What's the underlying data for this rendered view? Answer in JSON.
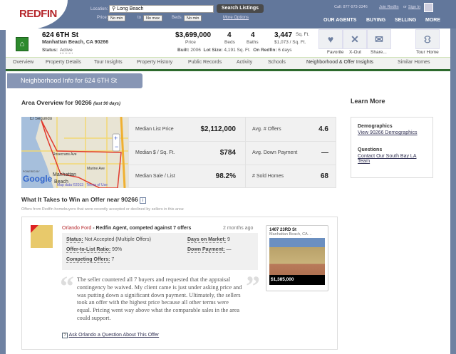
{
  "header": {
    "logo": "REDFIN",
    "location_label": "Location:",
    "location_value": "Long Beach",
    "search_button": "Search Listings",
    "price_label": "Price:",
    "price_min": "No min",
    "to_label": "to",
    "price_max": "No max",
    "beds_label": "Beds:",
    "beds_min": "No min",
    "more_options": "More Options",
    "phone": "Call: 877-973-3346",
    "join": "Join Redfin",
    "or": "or",
    "sign_in": "Sign In",
    "nav": [
      "OUR AGENTS",
      "BUYING",
      "SELLING",
      "MORE"
    ]
  },
  "property": {
    "address": "624 6TH St",
    "city": "Manhattan Beach, CA 90266",
    "status_label": "Status:",
    "status": "Active",
    "price": "$3,699,000",
    "price_label": "Price",
    "beds": "4",
    "beds_label": "Beds",
    "baths": "4",
    "baths_label": "Baths",
    "sqft": "3,447",
    "sqft_unit": "Sq. Ft.",
    "price_per_sqft": "$1,073 / Sq. Ft.",
    "built_label": "Built:",
    "built": "2006",
    "lot_label": "Lot Size:",
    "lot": "4,191 Sq. Ft.",
    "onredfin_label": "On Redfin:",
    "onredfin": "6 days",
    "actions": [
      "Favorite",
      "X-Out",
      "Share...",
      "Tour Home"
    ]
  },
  "tabs": [
    "Overview",
    "Property Details",
    "Tour Insights",
    "Property History",
    "Public Records",
    "Activity",
    "Schools",
    "Neighborhood & Offer Insights",
    "Similar Homes"
  ],
  "section_title": "Neighborhood Info for 624 6TH St",
  "area": {
    "title": "Area Overview for 90266",
    "period": "(last 90 days)",
    "map_labels": {
      "city1": "El Segundo",
      "city2": "Manhattan",
      "city3": "Beach",
      "street1": "Rosecrans Ave",
      "street2": "Marine Ave",
      "powered": "POWERED BY",
      "google": "Google",
      "mapdata": "Map data ©2013 · Terms of Use"
    },
    "stats": [
      {
        "label": "Median List Price",
        "value": "$2,112,000"
      },
      {
        "label": "Avg. # Offers",
        "value": "4.6"
      },
      {
        "label": "Median $ / Sq. Ft.",
        "value": "$784"
      },
      {
        "label": "Avg. Down Payment",
        "value": "—"
      },
      {
        "label": "Median Sale / List",
        "value": "98.2%"
      },
      {
        "label": "# Sold Homes",
        "value": "68"
      }
    ]
  },
  "learn_more": {
    "title": "Learn More",
    "demographics_title": "Demographics",
    "demographics_link": "View 90266 Demographics",
    "questions_title": "Questions",
    "questions_link": "Contact Our South Bay LA Team"
  },
  "offers": {
    "title": "What It Takes to Win an Offer near 90266",
    "subtitle": "Offers from Redfin homebuyers that were recently accepted or declined by sellers in this area:",
    "agent": "Orlando Ford",
    "agent_desc": "- Redfin Agent, competed against 7 offers",
    "time": "2 months ago",
    "status_label": "Status:",
    "status": "Not Accepted (Multiple Offers)",
    "dom_label": "Days on Market:",
    "dom": "9",
    "ratio_label": "Offer-to-List Ratio:",
    "ratio": "99%",
    "down_label": "Down Payment:",
    "down": "—",
    "competing_label": "Competing Offers:",
    "competing": "7",
    "quote": "The seller countered all 7 buyers and requested that the appraisal contingency be waived. My client came is just under asking price and was putting down a significant down payment. Ultimately, the sellers took an offer with the highest price because all other terms were equal. Pricing went way above what the comparable sales in the area could support.",
    "ask_link": "Ask Orlando a Question About This Offer",
    "comp": {
      "address": "1407 23RD St",
      "city": "Manhattan Beach, CA ...",
      "price": "$1,385,000"
    }
  }
}
